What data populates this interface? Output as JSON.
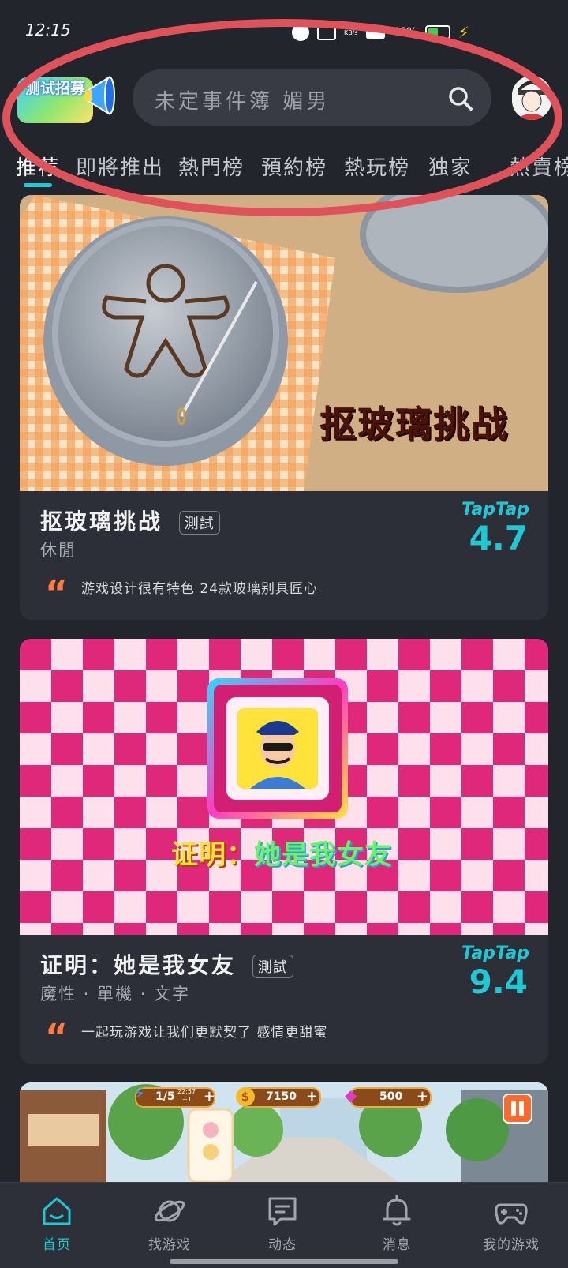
{
  "status_bar": {
    "time": "12:15",
    "net_speed": "KB/s",
    "battery": "48%",
    "battery_level": 0.48
  },
  "header": {
    "logo_text": "测试招募",
    "search_placeholder": "未定事件簿 媚男",
    "search_icon": "search-icon",
    "avatar_icon": "avatar-icon"
  },
  "tabs": [
    {
      "label": "推荐",
      "active": true
    },
    {
      "label": "即將推出"
    },
    {
      "label": "熱門榜"
    },
    {
      "label": "預約榜"
    },
    {
      "label": "熱玩榜"
    },
    {
      "label": "独家"
    },
    {
      "label": "熱賣榜"
    }
  ],
  "cards": [
    {
      "title": "抠玻璃挑战",
      "badge": "測試",
      "genre": "休閒",
      "taptap_label": "TapTap",
      "score": "4.7",
      "quote": "游戏设计很有特色 24款玻璃别具匠心",
      "banner_text": "抠玻璃挑战"
    },
    {
      "title": "证明：她是我女友",
      "badge": "測試",
      "genre": "魔性 · 單機 · 文字",
      "taptap_label": "TapTap",
      "score": "9.4",
      "quote": "一起玩游戏让我们更默契了 感情更甜蜜",
      "banner_text_1": "证明：",
      "banner_text_2": "她是我女友"
    },
    {
      "hud_energy": "1/5",
      "hud_timer": "22:57",
      "hud_timer_sub": "+1",
      "hud_coins": "7150",
      "hud_gems": "500"
    }
  ],
  "bottom_nav": [
    {
      "label": "首页",
      "icon": "home-icon",
      "active": true
    },
    {
      "label": "找游戏",
      "icon": "planet-icon"
    },
    {
      "label": "动态",
      "icon": "chat-icon"
    },
    {
      "label": "消息",
      "icon": "bell-icon"
    },
    {
      "label": "我的游戏",
      "icon": "gamepad-icon"
    }
  ],
  "colors": {
    "accent": "#1ec8d4",
    "background": "#23252c",
    "card": "#2c2f37",
    "quote": "#ff7b43",
    "highlight_ellipse": "#e0525a"
  }
}
